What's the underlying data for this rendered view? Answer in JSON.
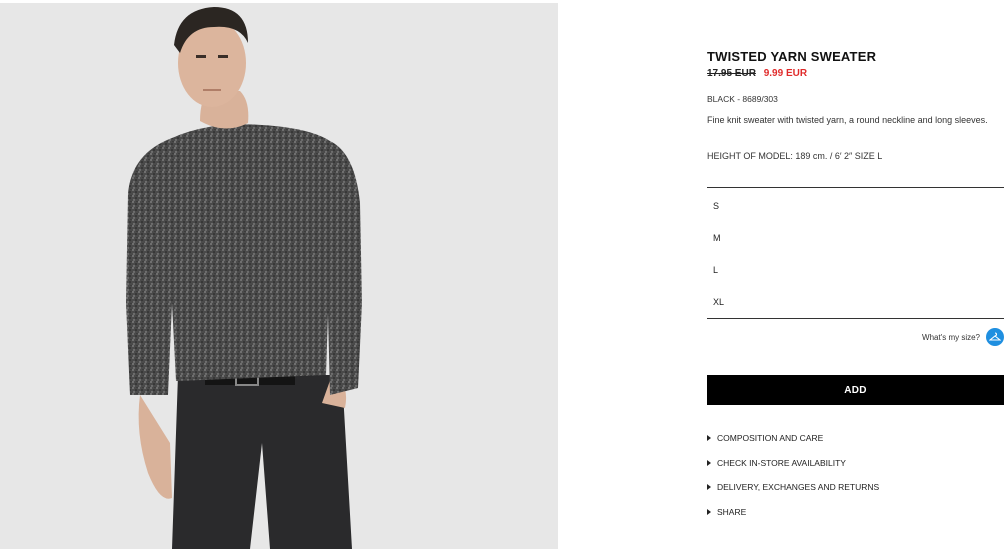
{
  "product": {
    "title": "TWISTED YARN SWEATER",
    "old_price": "17.95 EUR",
    "sale_price": "9.99 EUR",
    "color_ref": "BLACK - 8689/303",
    "description": "Fine knit sweater with twisted yarn, a round neckline and long sleeves.",
    "model_info": "HEIGHT OF MODEL: 189 cm. / 6′ 2″  SIZE L"
  },
  "sizes": [
    "S",
    "M",
    "L",
    "XL"
  ],
  "size_guide": {
    "label": "What's my size?",
    "icon": "hanger-icon"
  },
  "add_button": {
    "label": "ADD"
  },
  "links": [
    "COMPOSITION AND CARE",
    "CHECK IN-STORE AVAILABILITY",
    "DELIVERY, EXCHANGES AND RETURNS",
    "SHARE"
  ],
  "colors": {
    "sale": "#e02b2b",
    "button_bg": "#000000",
    "accent_icon": "#1f8fe0",
    "photo_bg": "#e7e7e7"
  }
}
